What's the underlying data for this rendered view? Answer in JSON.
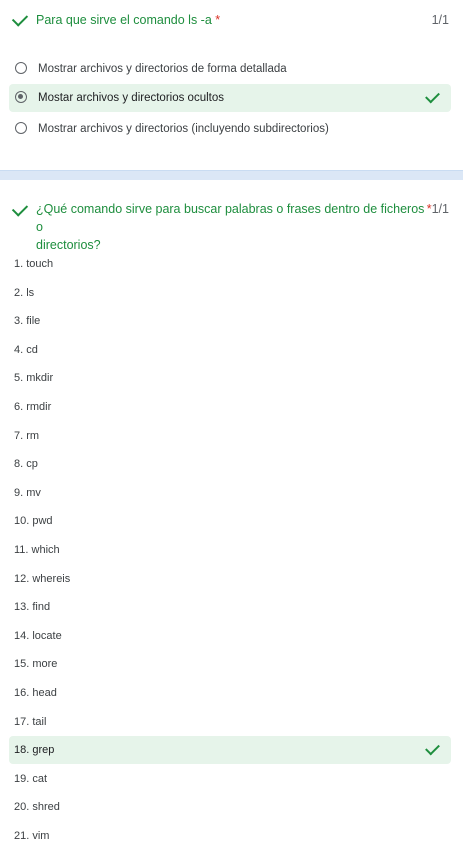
{
  "q1": {
    "title": "Para que sirve el comando ls -a",
    "required_mark": "*",
    "score": "1/1",
    "options": [
      {
        "label": "Mostrar archivos y directorios de forma detallada",
        "selected": false,
        "correct": false
      },
      {
        "label": "Mostar archivos y directorios ocultos",
        "selected": true,
        "correct": true
      },
      {
        "label": "Mostrar archivos y directorios (incluyendo subdirectorios)",
        "selected": false,
        "correct": false
      }
    ]
  },
  "q2": {
    "title_line1": "¿Qué comando sirve para buscar palabras o frases dentro de ficheros o",
    "title_line2": "directorios?",
    "required_mark": "*",
    "score": "1/1",
    "items": [
      "1. touch",
      "2. ls",
      "3. file",
      "4. cd",
      "5. mkdir",
      "6. rmdir",
      "7. rm",
      "8. cp",
      "9. mv",
      "10. pwd",
      "11. which",
      "12. whereis",
      "13. find",
      "14. locate",
      "15. more",
      "16. head",
      "17. tail",
      "18. grep",
      "19. cat",
      "20. shred",
      "21. vim"
    ],
    "correct_index": 17
  },
  "colors": {
    "accent_green": "#1e8e3e",
    "correct_bg": "#e6f4ea",
    "required_red": "#d93025"
  }
}
